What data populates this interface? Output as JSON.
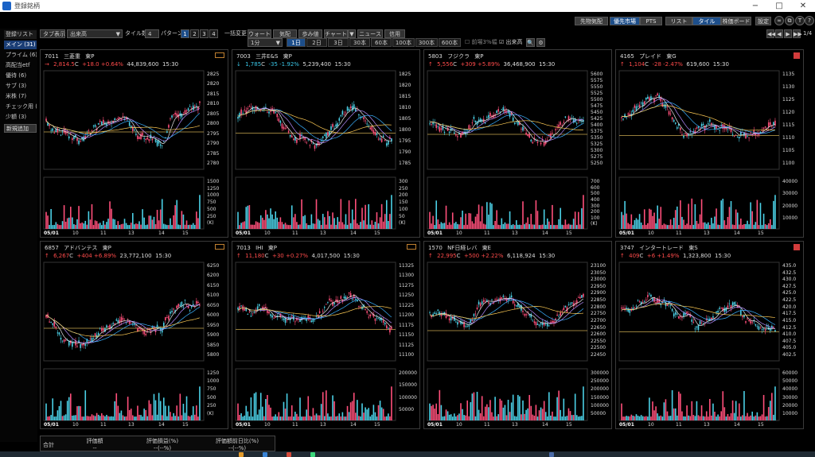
{
  "window": {
    "title": "登録銘柄",
    "min": "−",
    "max": "□",
    "close": "✕"
  },
  "top_buttons": [
    {
      "label": "先物気配",
      "active": false
    },
    {
      "label": "優先市場",
      "active": true
    },
    {
      "label": "PTS",
      "active": false
    },
    {
      "label": "リスト",
      "active": false
    },
    {
      "label": "タイル",
      "active": true
    },
    {
      "label": "株価ボード",
      "active": false
    },
    {
      "label": "設定",
      "active": false
    }
  ],
  "icons": [
    "link-icon",
    "copy-icon",
    "text-icon",
    "help-icon"
  ],
  "icon_glyphs": [
    "∞",
    "⧉",
    "T",
    "?"
  ],
  "sidebar": {
    "header": "登録リスト",
    "items": [
      "メイン (31)",
      "プライム (6)",
      "高配当etf",
      "優待 (6)",
      "サブ (3)",
      "米株 (7)",
      "チェック用 (",
      "少額 (3)"
    ],
    "add": "新規追加"
  },
  "toolbar": {
    "tab_label": "タブ表示",
    "sort_value": "出来高",
    "tile_count_label": "タイル数",
    "tile_count_value": "4",
    "pattern_label": "パターン",
    "patterns": [
      "1",
      "2",
      "3",
      "4"
    ],
    "bulk_label": "一括変更",
    "buttons": [
      "ウォート",
      "気配",
      "歩み値",
      "チャート",
      "ニュース",
      "信用"
    ],
    "interval_value": "1分",
    "periods": [
      "1日",
      "2日",
      "3日",
      "30本",
      "60本",
      "100本",
      "300本",
      "600本"
    ],
    "cb1": "前場3%幅",
    "cb2": "出来高",
    "page": "1/4",
    "nav": [
      "◀◀",
      "◀",
      "▶",
      "▶▶"
    ],
    "zoom_icons": [
      "🔍",
      "⚙"
    ]
  },
  "tiles": [
    {
      "code": "7011",
      "name": "三菱重",
      "market": "東P",
      "dir": "→",
      "price": "2,814.5",
      "suffix": "C",
      "change": "+18.0 +0.64%",
      "volume": "44,839,600",
      "time": "15:30",
      "color": "up",
      "mark": "badge",
      "x_labels": [
        "05/01",
        "10",
        "11",
        "13",
        "14",
        "15"
      ],
      "y_labels": [
        "2825",
        "2820",
        "2815",
        "2810",
        "2805",
        "2800",
        "2795",
        "2790",
        "2785",
        "2780"
      ],
      "v_labels": [
        "1500",
        "1250",
        "1000",
        "750",
        "500",
        "250",
        "(K)"
      ]
    },
    {
      "code": "7003",
      "name": "三井E&S",
      "market": "東P",
      "dir": "↓",
      "price": "1,785",
      "suffix": "C",
      "change": "-35 -1.92%",
      "volume": "5,239,400",
      "time": "15:30",
      "color": "dn",
      "mark": "",
      "x_labels": [
        "05/01",
        "10",
        "11",
        "13",
        "14",
        "15"
      ],
      "y_labels": [
        "1825",
        "1820",
        "1815",
        "1810",
        "1805",
        "1800",
        "1795",
        "1790",
        "1785"
      ],
      "v_labels": [
        "300",
        "250",
        "200",
        "150",
        "100",
        "50",
        "(K)"
      ]
    },
    {
      "code": "5803",
      "name": "フジクラ",
      "market": "東P",
      "dir": "↑",
      "price": "5,556",
      "suffix": "C",
      "change": "+309 +5.89%",
      "volume": "36,468,900",
      "time": "15:30",
      "color": "up",
      "mark": "",
      "x_labels": [
        "05/01",
        "10",
        "11",
        "13",
        "14",
        "15"
      ],
      "y_labels": [
        "5600",
        "5575",
        "5550",
        "5525",
        "5500",
        "5475",
        "5450",
        "5425",
        "5400",
        "5375",
        "5350",
        "5325",
        "5300",
        "5275",
        "5250"
      ],
      "v_labels": [
        "700",
        "600",
        "500",
        "400",
        "300",
        "200",
        "100",
        "(K)"
      ]
    },
    {
      "code": "4165",
      "name": "プレイド",
      "market": "東G",
      "dir": "↑",
      "price": "1,104",
      "suffix": "C",
      "change": "-28 -2.47%",
      "volume": "619,600",
      "time": "15:30",
      "color": "up",
      "mark": "alert",
      "x_labels": [
        "05/01",
        "10",
        "11",
        "13",
        "14",
        "15"
      ],
      "y_labels": [
        "1135",
        "1130",
        "1125",
        "1120",
        "1115",
        "1110",
        "1105",
        "1100"
      ],
      "v_labels": [
        "40000",
        "30000",
        "20000",
        "10000"
      ]
    },
    {
      "code": "6857",
      "name": "アドバンテス",
      "market": "東P",
      "dir": "↑",
      "price": "6,267",
      "suffix": "C",
      "change": "+404 +6.89%",
      "volume": "23,772,100",
      "time": "15:30",
      "color": "up",
      "mark": "badge",
      "x_labels": [
        "05/01",
        "10",
        "11",
        "13",
        "14",
        "15"
      ],
      "y_labels": [
        "6250",
        "6200",
        "6150",
        "6100",
        "6050",
        "6000",
        "5950",
        "5900",
        "5850",
        "5800"
      ],
      "v_labels": [
        "1250",
        "1000",
        "750",
        "500",
        "250",
        "(K)"
      ]
    },
    {
      "code": "7013",
      "name": "IHI",
      "market": "東P",
      "dir": "↑",
      "price": "11,180",
      "suffix": "C",
      "change": "+30 +0.27%",
      "volume": "4,017,500",
      "time": "15:30",
      "color": "up",
      "mark": "badge",
      "x_labels": [
        "05/01",
        "10",
        "11",
        "13",
        "14",
        "15"
      ],
      "y_labels": [
        "11325",
        "11300",
        "11275",
        "11250",
        "11225",
        "11200",
        "11175",
        "11150",
        "11125",
        "11100"
      ],
      "v_labels": [
        "200000",
        "150000",
        "100000",
        "50000"
      ]
    },
    {
      "code": "1570",
      "name": "NF日経レバ",
      "market": "東E",
      "dir": "↑",
      "price": "22,995",
      "suffix": "C",
      "change": "+500 +2.22%",
      "volume": "6,118,924",
      "time": "15:30",
      "color": "up",
      "mark": "",
      "x_labels": [
        "05/01",
        "10",
        "11",
        "13",
        "14",
        "15"
      ],
      "y_labels": [
        "23100",
        "23050",
        "23000",
        "22950",
        "22900",
        "22850",
        "22800",
        "22750",
        "22700",
        "22650",
        "22600",
        "22550",
        "22500",
        "22450"
      ],
      "v_labels": [
        "300000",
        "250000",
        "200000",
        "150000",
        "100000",
        "50000"
      ]
    },
    {
      "code": "3747",
      "name": "インタートレード",
      "market": "東S",
      "dir": "↑",
      "price": "409",
      "suffix": "C",
      "change": "+6 +1.49%",
      "volume": "1,323,800",
      "time": "15:30",
      "color": "up",
      "mark": "alert",
      "x_labels": [
        "05/01",
        "10",
        "11",
        "13",
        "14",
        "15"
      ],
      "y_labels": [
        "435.0",
        "432.5",
        "430.0",
        "427.5",
        "425.0",
        "422.5",
        "420.0",
        "417.5",
        "415.0",
        "412.5",
        "410.0",
        "407.5",
        "405.0",
        "402.5"
      ],
      "v_labels": [
        "60000",
        "50000",
        "40000",
        "30000",
        "20000",
        "10000"
      ]
    }
  ],
  "bottom": {
    "label": "合計",
    "headers": [
      "評価額",
      "評価損益(%)",
      "評価額前日比(%)"
    ],
    "values": [
      "--",
      "--(--%)",
      "--(--%)"
    ]
  },
  "colors": {
    "up": "#ff4b4b",
    "down": "#39c6e6",
    "accent": "#1d4e8a",
    "candle_up": "#ff4f7a",
    "candle_dn": "#4bd0e6"
  }
}
